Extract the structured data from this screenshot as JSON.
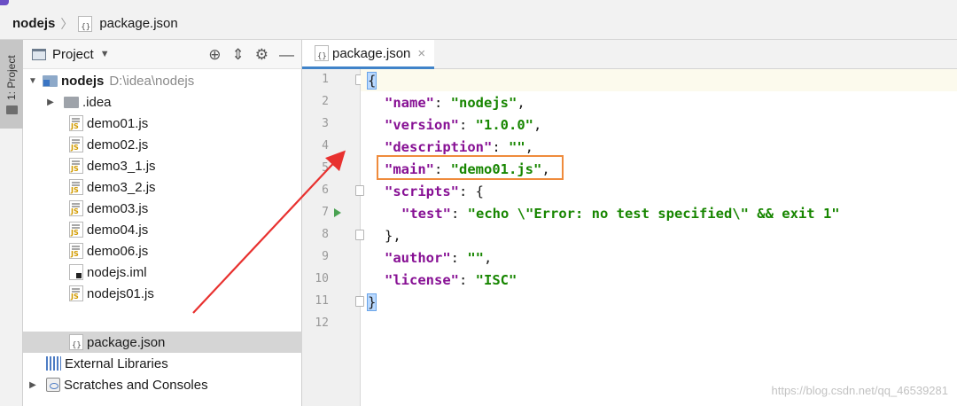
{
  "breadcrumb": {
    "root": "nodejs",
    "file": "package.json"
  },
  "tool_stripe": {
    "project_tab": "1: Project"
  },
  "project_panel": {
    "title": "Project",
    "root": {
      "name": "nodejs",
      "path": "D:\\idea\\nodejs"
    },
    "items": [
      {
        "label": ".idea",
        "icon": "folder-icon"
      },
      {
        "label": "demo01.js",
        "icon": "js-file-icon"
      },
      {
        "label": "demo02.js",
        "icon": "js-file-icon"
      },
      {
        "label": "demo3_1.js",
        "icon": "js-file-icon"
      },
      {
        "label": "demo3_2.js",
        "icon": "js-file-icon"
      },
      {
        "label": "demo03.js",
        "icon": "js-file-icon"
      },
      {
        "label": "demo04.js",
        "icon": "js-file-icon"
      },
      {
        "label": "demo06.js",
        "icon": "js-file-icon"
      },
      {
        "label": "nodejs.iml",
        "icon": "iml-file-icon"
      },
      {
        "label": "nodejs01.js",
        "icon": "js-file-icon"
      },
      {
        "label": "package.json",
        "icon": "json-file-icon",
        "selected": true
      }
    ],
    "external_libraries": "External Libraries",
    "scratches": "Scratches and Consoles"
  },
  "editor": {
    "tab_label": "package.json",
    "line_numbers": [
      "1",
      "2",
      "3",
      "4",
      "5",
      "6",
      "7",
      "8",
      "9",
      "10",
      "11",
      "12"
    ],
    "lines": {
      "l1": "{",
      "l2_key": "\"name\"",
      "l2_val": "\"nodejs\"",
      "l3_key": "\"version\"",
      "l3_val": "\"1.0.0\"",
      "l4_key": "\"description\"",
      "l4_val": "\"\"",
      "l5_key": "\"main\"",
      "l5_val": "\"demo01.js\"",
      "l6_key": "\"scripts\"",
      "l7_key": "\"test\"",
      "l7_val": "\"echo \\\"Error: no test specified\\\" && exit 1\"",
      "l8": "},",
      "l9_key": "\"author\"",
      "l9_val": "\"\"",
      "l10_key": "\"license\"",
      "l10_val": "\"ISC\"",
      "l11": "}"
    }
  },
  "watermark": "https://blog.csdn.net/qq_46539281",
  "colors": {
    "key": "#871094",
    "string": "#178600",
    "highlight_box": "#ef8b3c",
    "arrow": "#e8312f",
    "selection": "#d5d5d5"
  }
}
